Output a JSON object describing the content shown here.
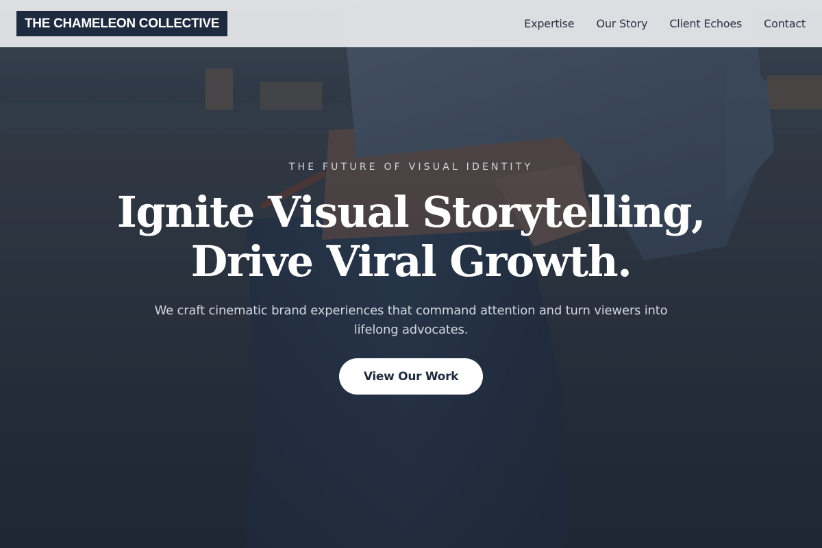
{
  "brand": {
    "name": "THE CHAMELEON COLLECTIVE"
  },
  "nav": {
    "items": [
      {
        "label": "Expertise"
      },
      {
        "label": "Our Story"
      },
      {
        "label": "Client Echoes"
      },
      {
        "label": "Contact"
      }
    ]
  },
  "hero": {
    "eyebrow": "THE FUTURE OF VISUAL IDENTITY",
    "headline_line1": "Ignite Visual Storytelling,",
    "headline_line2": "Drive Viral Growth.",
    "subtext": "We craft cinematic brand experiences that command attention and turn viewers into lifelong advocates.",
    "cta_label": "View Our Work",
    "background_image": "person-in-denim-jacket-photo"
  },
  "colors": {
    "brand_bg": "#1e2a3e",
    "navbar_bg": "#e8eaec",
    "overlay": "#1e2634",
    "cta_bg": "#ffffff",
    "cta_text": "#1e2a3e"
  }
}
